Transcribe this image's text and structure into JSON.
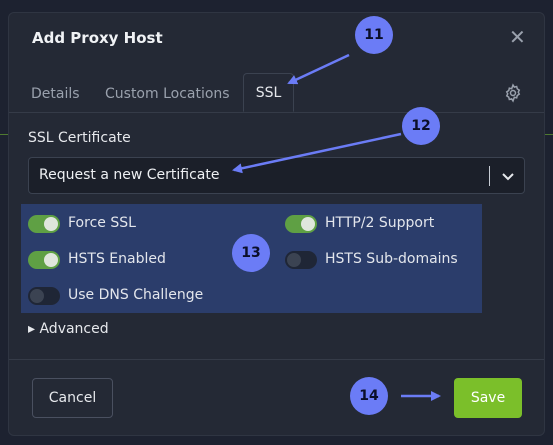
{
  "modal": {
    "title": "Add Proxy Host"
  },
  "tabs": [
    {
      "label": "Details"
    },
    {
      "label": "Custom Locations"
    },
    {
      "label": "SSL",
      "active": true
    }
  ],
  "ssl": {
    "certificate_label": "SSL Certificate",
    "certificate_value": "Request a new Certificate",
    "options": [
      {
        "label": "Force SSL",
        "enabled": true
      },
      {
        "label": "HTTP/2 Support",
        "enabled": true
      },
      {
        "label": "HSTS Enabled",
        "enabled": true
      },
      {
        "label": "HSTS Sub-domains",
        "enabled": false
      },
      {
        "label": "Use DNS Challenge",
        "enabled": false
      }
    ],
    "advanced_label": "▸ Advanced"
  },
  "footer": {
    "cancel_label": "Cancel",
    "save_label": "Save"
  },
  "annotations": [
    "11",
    "12",
    "13",
    "14"
  ],
  "colors": {
    "accent": "#6b7cf6",
    "save": "#7bbf2a",
    "toggle_on": "#5fa044",
    "highlight": "#2b3d6b"
  }
}
